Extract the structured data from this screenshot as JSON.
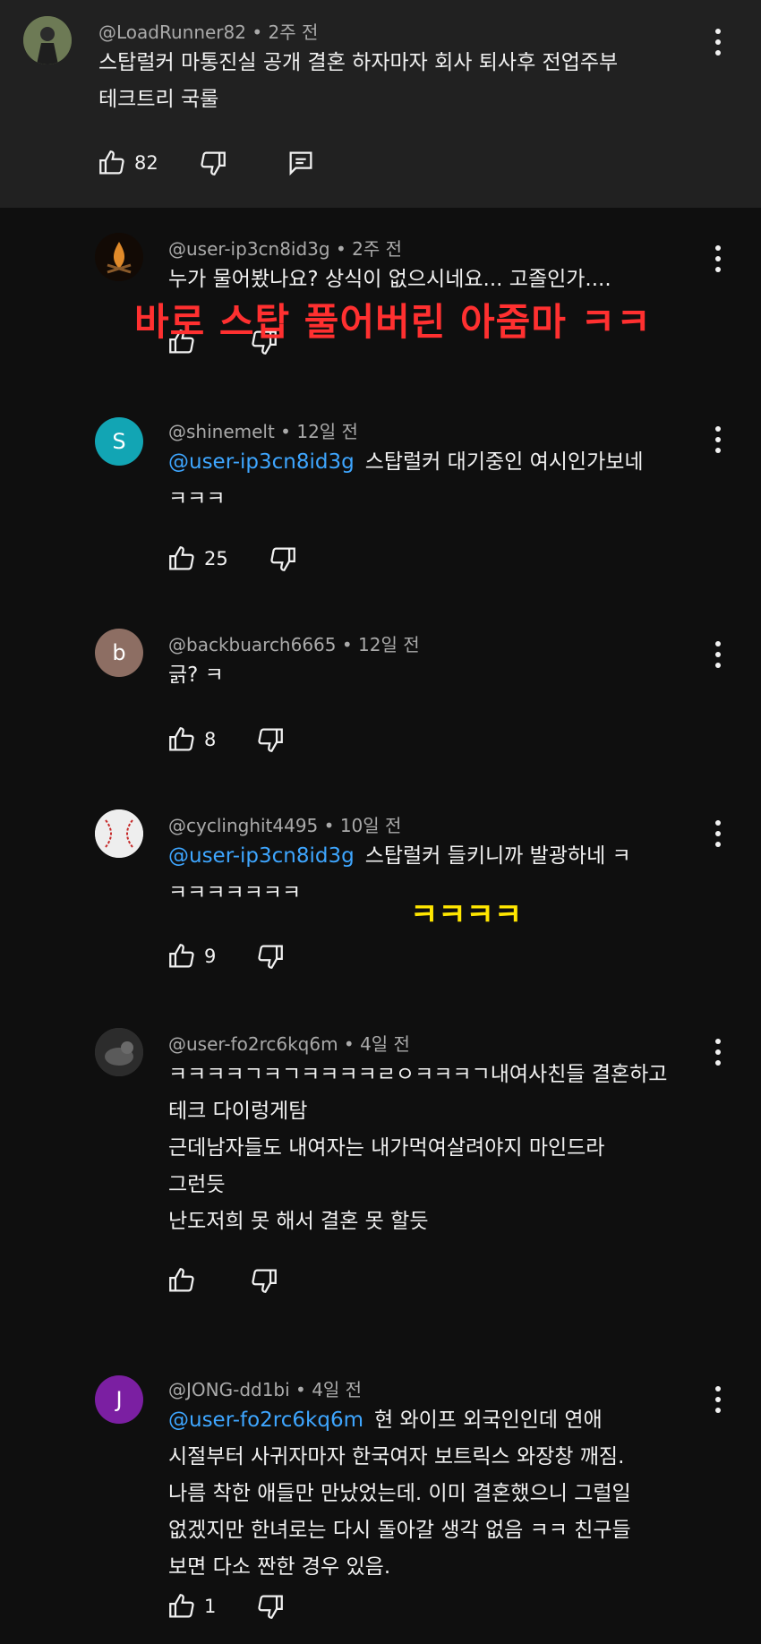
{
  "comments": [
    {
      "author": "@LoadRunner82",
      "time": "2주 전",
      "lines": [
        "스탑럴커 마통진실 공개 결혼 하자마자 회사 퇴사후 전업주부",
        "테크트리 국룰"
      ],
      "likes": "82",
      "avatar_letter": "",
      "avatar_color": "#4a5a3a"
    },
    {
      "author": "@user-ip3cn8id3g",
      "time": "2주 전",
      "lines": [
        "누가 물어봤나요? 상식이 없으시네요... 고졸인가...."
      ],
      "likes": "",
      "avatar_letter": "",
      "avatar_color": "#2a1a10"
    },
    {
      "author": "@shinemelt",
      "time": "12일 전",
      "mention": "@user-ip3cn8id3g",
      "lines": [
        "스탑럴커 대기중인 여시인가보네",
        "ㅋㅋㅋ"
      ],
      "likes": "25",
      "avatar_letter": "S",
      "avatar_color": "#12a5b4"
    },
    {
      "author": "@backbuarch6665",
      "time": "12일 전",
      "lines": [
        "긁? ㅋ"
      ],
      "likes": "8",
      "avatar_letter": "b",
      "avatar_color": "#8d6e63"
    },
    {
      "author": "@cyclinghit4495",
      "time": "10일 전",
      "mention": "@user-ip3cn8id3g",
      "lines": [
        "스탑럴커 들키니까 발광하네 ㅋ",
        "ㅋㅋㅋㅋㅋㅋㅋ"
      ],
      "likes": "9",
      "avatar_letter": "",
      "avatar_color": "#e8e8e8"
    },
    {
      "author": "@user-fo2rc6kq6m",
      "time": "4일 전",
      "lines": [
        "ㅋㅋㅋㅋㄱㅋㄱㅋㅋㅋㅋㄹㅇㅋㅋㅋㄱ내여사친들 결혼하고",
        "테크 다이렁게탐",
        "근데남자들도 내여자는 내가먹여살려야지 마인드라",
        "그런듯",
        "난도저희 못 해서 결혼 못 할듯"
      ],
      "likes": "",
      "avatar_letter": "",
      "avatar_color": "#3a3a3a"
    },
    {
      "author": "@JONG-dd1bi",
      "time": "4일 전",
      "mention": "@user-fo2rc6kq6m",
      "lines": [
        "현 와이프 외국인인데 연애",
        "시절부터 사귀자마자 한국여자 보트릭스 와장창 깨짐.",
        "나름 착한 애들만 만났었는데. 이미 결혼했으니 그럴일",
        "없겠지만 한녀로는 다시 돌아갈 생각 없음 ㅋㅋ 친구들",
        "보면 다소 짠한 경우 있음."
      ],
      "likes": "1",
      "avatar_letter": "J",
      "avatar_color": "#7b1fa2"
    }
  ],
  "overlays": {
    "red": "바로 스탑 풀어버린 아줌마 ㅋㅋ",
    "yellow": "ㅋㅋㅋㅋ"
  }
}
